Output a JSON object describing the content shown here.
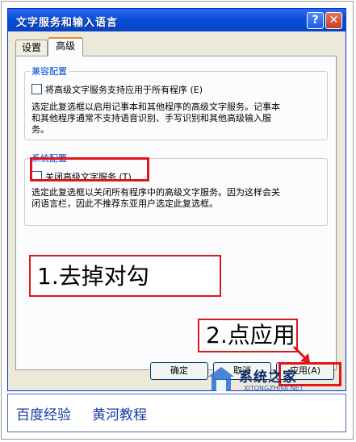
{
  "window": {
    "title": "文字服务和输入语言"
  },
  "titlebar": {
    "help_label": "?",
    "close_label": "✕"
  },
  "tabs": [
    {
      "label": "设置",
      "selected": false
    },
    {
      "label": "高级",
      "selected": true
    }
  ],
  "compat_group": {
    "label": "兼容配置",
    "checkbox_label": "将高级文字服务支持应用于所有程序 (E)",
    "checked": false,
    "description_line1": "选定此复选框以启用记事本和其他程序的高级文字服务。记事本",
    "description_line2": "和其他程序通常不支持语音识别、手写识别和其他高级输入服",
    "description_line3": "务。"
  },
  "system_group": {
    "label": "系统配置",
    "checkbox_label": "关闭高级文字服务 (T)",
    "checked": false,
    "description_line1": "选定此复选框以关闭所有程序中的高级文字服务。因为这样会关",
    "description_line2": "闭语言栏，因此不推荐东亚用户选定此复选框。"
  },
  "annotations": {
    "step1": "1.去掉对勾",
    "step2": "2.点应用"
  },
  "buttons": {
    "ok": "确定",
    "cancel": "取消",
    "apply": "应用(A)"
  },
  "watermark": {
    "title": "系统之家",
    "url": "XITONGZHIJIA.NET"
  },
  "footer": {
    "text1": "百度经验",
    "text2": "黄河教程"
  },
  "colors": {
    "titlebar": "#0a4fd8",
    "annotation_red": "#e0141b",
    "footer_text": "#1a3aa6"
  }
}
